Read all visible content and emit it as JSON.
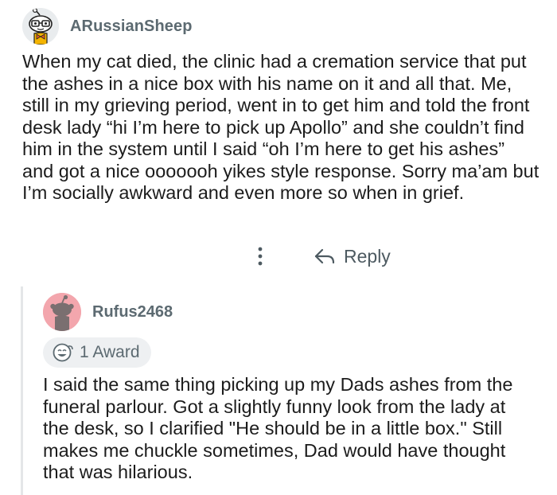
{
  "comment": {
    "author": "ARussianSheep",
    "avatar_icon": "snoo-avatar-with-glasses-icon",
    "body": "When my cat died, the clinic had a cremation service that put the ashes in a nice box with his name on it and all that. Me, still in my grieving period, went in to get him and told the front desk lady “hi I’m here to pick up Apollo” and she couldn’t find him in the system until I said “oh I’m here to get his ashes” and got a nice ooooooh yikes style response. Sorry ma’am but I’m socially awkward and even more so when in grief.",
    "actions": {
      "more_icon": "vertical-ellipsis-icon",
      "reply_icon": "reply-arrow-icon",
      "reply_label": "Reply"
    }
  },
  "reply": {
    "author": "Rufus2468",
    "avatar_icon": "default-snoo-avatar-icon",
    "avatar_color": "#f3a6ad",
    "award": {
      "icon": "award-icon",
      "label": "1 Award"
    },
    "body": "I said the same thing picking up my Dads ashes from the funeral parlour. Got a slightly funny look from the lady at the desk, so I clarified \"He should be in a little box.\" Still makes me chuckle sometimes, Dad would have thought that was hilarious."
  },
  "colors": {
    "username": "#5c6a71",
    "text": "#1c1c1c",
    "thread_line": "#e4e6e8",
    "award_bg": "#eef0f2"
  }
}
